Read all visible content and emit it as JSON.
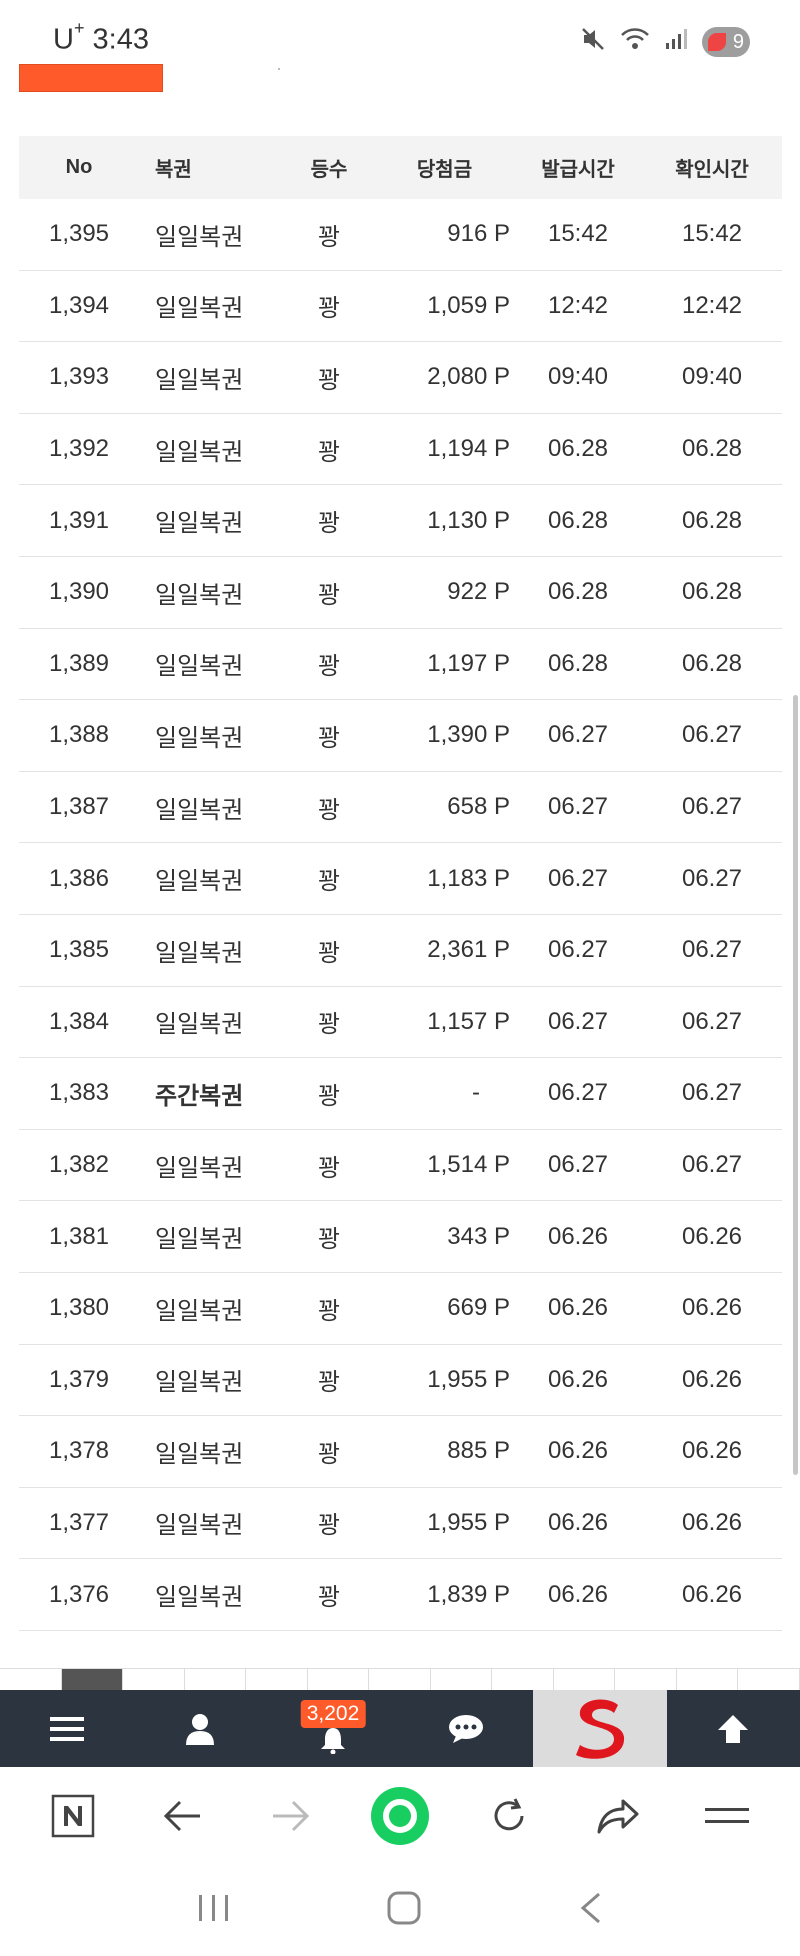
{
  "status_bar": {
    "carrier": "U",
    "carrier_sup": "+",
    "time": "3:43",
    "battery": "9"
  },
  "table": {
    "headers": {
      "no": "No",
      "name": "복권",
      "rank": "등수",
      "prize": "당첨금",
      "issued": "발급시간",
      "checked": "확인시간"
    },
    "rows": [
      {
        "no": "1,395",
        "name": "일일복권",
        "rank": "꽝",
        "prize": "916 P",
        "issued": "15:42",
        "checked": "15:42"
      },
      {
        "no": "1,394",
        "name": "일일복권",
        "rank": "꽝",
        "prize": "1,059 P",
        "issued": "12:42",
        "checked": "12:42"
      },
      {
        "no": "1,393",
        "name": "일일복권",
        "rank": "꽝",
        "prize": "2,080 P",
        "issued": "09:40",
        "checked": "09:40"
      },
      {
        "no": "1,392",
        "name": "일일복권",
        "rank": "꽝",
        "prize": "1,194 P",
        "issued": "06.28",
        "checked": "06.28"
      },
      {
        "no": "1,391",
        "name": "일일복권",
        "rank": "꽝",
        "prize": "1,130 P",
        "issued": "06.28",
        "checked": "06.28"
      },
      {
        "no": "1,390",
        "name": "일일복권",
        "rank": "꽝",
        "prize": "922 P",
        "issued": "06.28",
        "checked": "06.28"
      },
      {
        "no": "1,389",
        "name": "일일복권",
        "rank": "꽝",
        "prize": "1,197 P",
        "issued": "06.28",
        "checked": "06.28"
      },
      {
        "no": "1,388",
        "name": "일일복권",
        "rank": "꽝",
        "prize": "1,390 P",
        "issued": "06.27",
        "checked": "06.27"
      },
      {
        "no": "1,387",
        "name": "일일복권",
        "rank": "꽝",
        "prize": "658 P",
        "issued": "06.27",
        "checked": "06.27"
      },
      {
        "no": "1,386",
        "name": "일일복권",
        "rank": "꽝",
        "prize": "1,183 P",
        "issued": "06.27",
        "checked": "06.27"
      },
      {
        "no": "1,385",
        "name": "일일복권",
        "rank": "꽝",
        "prize": "2,361 P",
        "issued": "06.27",
        "checked": "06.27"
      },
      {
        "no": "1,384",
        "name": "일일복권",
        "rank": "꽝",
        "prize": "1,157 P",
        "issued": "06.27",
        "checked": "06.27"
      },
      {
        "no": "1,383",
        "name": "주간복권",
        "rank": "꽝",
        "prize": "-",
        "issued": "06.27",
        "checked": "06.27",
        "bold": true
      },
      {
        "no": "1,382",
        "name": "일일복권",
        "rank": "꽝",
        "prize": "1,514 P",
        "issued": "06.27",
        "checked": "06.27"
      },
      {
        "no": "1,381",
        "name": "일일복권",
        "rank": "꽝",
        "prize": "343 P",
        "issued": "06.26",
        "checked": "06.26"
      },
      {
        "no": "1,380",
        "name": "일일복권",
        "rank": "꽝",
        "prize": "669 P",
        "issued": "06.26",
        "checked": "06.26"
      },
      {
        "no": "1,379",
        "name": "일일복권",
        "rank": "꽝",
        "prize": "1,955 P",
        "issued": "06.26",
        "checked": "06.26"
      },
      {
        "no": "1,378",
        "name": "일일복권",
        "rank": "꽝",
        "prize": "885 P",
        "issued": "06.26",
        "checked": "06.26"
      },
      {
        "no": "1,377",
        "name": "일일복권",
        "rank": "꽝",
        "prize": "1,955 P",
        "issued": "06.26",
        "checked": "06.26"
      },
      {
        "no": "1,376",
        "name": "일일복권",
        "rank": "꽝",
        "prize": "1,839 P",
        "issued": "06.26",
        "checked": "06.26"
      }
    ]
  },
  "bottom_bar": {
    "items": [
      "menu-icon",
      "user-icon",
      "bell-icon",
      "chat-icon",
      "site-logo",
      "arrow-up-icon"
    ],
    "notification_count": "3,202",
    "accent": "#ff5a2a",
    "bg": "#2c3440"
  },
  "browser_toolbar": {
    "items": [
      "naver-icon",
      "back-icon",
      "forward-icon",
      "home-icon",
      "reload-icon",
      "share-icon",
      "menu-icon"
    ],
    "accent": "#19ce60"
  },
  "system_nav": {
    "items": [
      "recent-apps-icon",
      "home-icon",
      "back-icon"
    ]
  }
}
